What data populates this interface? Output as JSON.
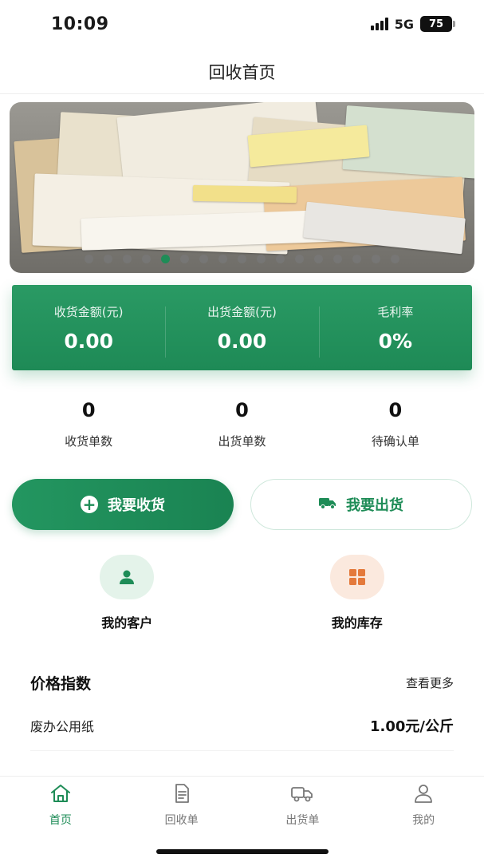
{
  "status_bar": {
    "time": "10:09",
    "network": "5G",
    "battery": "75"
  },
  "nav": {
    "title": "回收首页"
  },
  "banner": {
    "total_slides": 17,
    "active_index": 4
  },
  "stats": [
    {
      "label": "收货金额(元)",
      "value": "0.00"
    },
    {
      "label": "出货金额(元)",
      "value": "0.00"
    },
    {
      "label": "毛利率",
      "value": "0%"
    }
  ],
  "counts": [
    {
      "value": "0",
      "label": "收货单数"
    },
    {
      "value": "0",
      "label": "出货单数"
    },
    {
      "value": "0",
      "label": "待确认单"
    }
  ],
  "actions": {
    "receive": "我要收货",
    "ship": "我要出货"
  },
  "shortcuts": {
    "customers": "我的客户",
    "inventory": "我的库存"
  },
  "price_index": {
    "title": "价格指数",
    "more": "查看更多",
    "items": [
      {
        "name": "废办公用纸",
        "price": "1.00元/公斤"
      }
    ]
  },
  "tabs": [
    {
      "label": "首页",
      "icon": "home-icon",
      "active": true
    },
    {
      "label": "回收单",
      "icon": "document-icon",
      "active": false
    },
    {
      "label": "出货单",
      "icon": "truck-icon",
      "active": false
    },
    {
      "label": "我的",
      "icon": "user-icon",
      "active": false
    }
  ],
  "colors": {
    "brand_green": "#1e8c57",
    "accent_orange": "#e47a3c",
    "active_dot": "#1e8c57"
  }
}
